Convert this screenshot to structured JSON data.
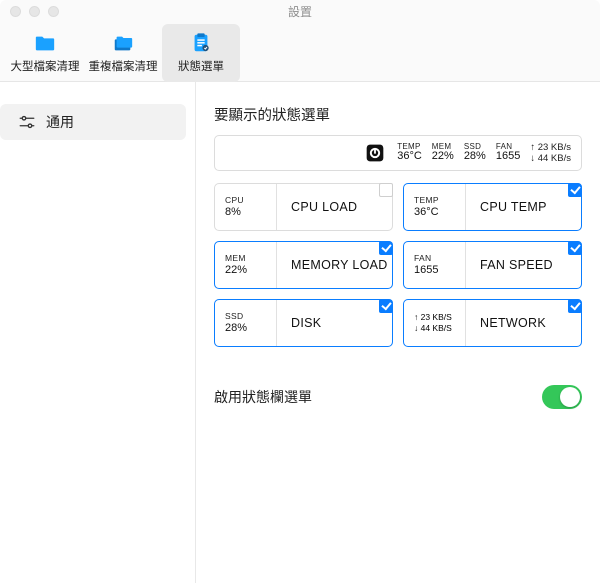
{
  "window": {
    "title": "設置"
  },
  "toolbar": {
    "items": [
      {
        "id": "large-files",
        "label": "大型檔案清理"
      },
      {
        "id": "dup-files",
        "label": "重複檔案清理"
      },
      {
        "id": "status-menu",
        "label": "狀態選單"
      }
    ],
    "selected": "status-menu"
  },
  "sidebar": {
    "items": [
      {
        "id": "general",
        "label": "通用"
      }
    ],
    "selected": "general"
  },
  "status_section": {
    "title": "要顯示的狀態選單",
    "preview": {
      "temp": {
        "label": "TEMP",
        "value": "36°C"
      },
      "mem": {
        "label": "MEM",
        "value": "22%"
      },
      "ssd": {
        "label": "SSD",
        "value": "28%"
      },
      "fan": {
        "label": "FAN",
        "value": "1655"
      },
      "net": {
        "up": "↑ 23 KB/s",
        "down": "↓ 44 KB/s"
      }
    },
    "cards": [
      {
        "id": "cpu",
        "mini_label": "CPU",
        "mini_value": "8%",
        "title": "CPU LOAD",
        "selected": false
      },
      {
        "id": "temp",
        "mini_label": "TEMP",
        "mini_value": "36°C",
        "title": "CPU TEMP",
        "selected": true
      },
      {
        "id": "mem",
        "mini_label": "MEM",
        "mini_value": "22%",
        "title": "MEMORY LOAD",
        "selected": true
      },
      {
        "id": "fan",
        "mini_label": "FAN",
        "mini_value": "1655",
        "title": "FAN SPEED",
        "selected": true
      },
      {
        "id": "ssd",
        "mini_label": "SSD",
        "mini_value": "28%",
        "title": "DISK",
        "selected": true
      },
      {
        "id": "net",
        "mini_up": "↑ 23 KB/S",
        "mini_down": "↓ 44 KB/S",
        "title": "NETWORK",
        "selected": true
      }
    ]
  },
  "enable_menubar": {
    "label": "啟用狀態欄選單",
    "value": true
  },
  "colors": {
    "accent": "#0a7dff",
    "switch_on": "#34c759",
    "folder": "#1aa1ff"
  }
}
